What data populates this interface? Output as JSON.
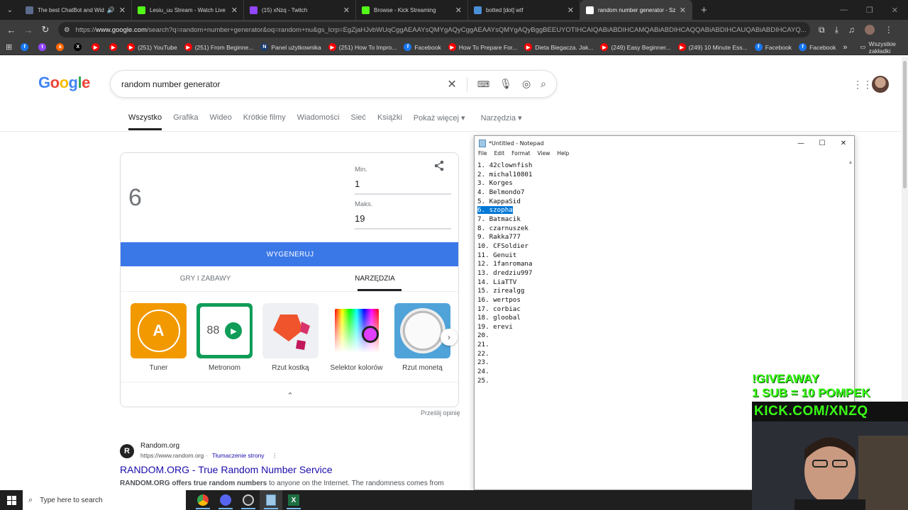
{
  "browser": {
    "tabs": [
      {
        "label": "The best ChatBot and Widg",
        "color": "#5a6b8c",
        "audio": true
      },
      {
        "label": "Lesiu_uu Stream - Watch Live o",
        "color": "#53fc18"
      },
      {
        "label": "(15) xNzq - Twitch",
        "color": "#9146ff"
      },
      {
        "label": "Browse - Kick Streaming",
        "color": "#53fc18"
      },
      {
        "label": "botted [dot] wtf",
        "color": "#4a90d9"
      },
      {
        "label": "random number generator - Sz",
        "color": "#ffffff",
        "active": true
      }
    ],
    "url_prefix": "https://",
    "url_host": "www.google.com",
    "url_rest": "/search?q=random+number+generator&oq=random+nu&gs_lcrp=EgZjaHJvbWUqCggAEAAYsQMYgAQyCggAEAAYsQMYgAQyBggBEEUYOTIHCAIQABiABDIHCAMQABiABDIHCAQQABiABDIHCAUQABiABDIHCAYQ...",
    "bookmarks": [
      {
        "label": "",
        "color": "#1877f2",
        "glyph": "f"
      },
      {
        "label": "",
        "color": "#9146ff",
        "glyph": "t"
      },
      {
        "label": "",
        "color": "#ff6600",
        "glyph": "a"
      },
      {
        "label": "",
        "color": "#000000",
        "glyph": "X"
      },
      {
        "label": "",
        "color": "#ff0000",
        "glyph": "▶"
      },
      {
        "label": "",
        "color": "#ff0000",
        "glyph": "▶"
      },
      {
        "label": "(251) YouTube",
        "color": "#ff0000",
        "glyph": "▶"
      },
      {
        "label": "(251) From Beginne...",
        "color": "#ff0000",
        "glyph": "▶"
      },
      {
        "label": "Panel użytkownika",
        "color": "#1a3c6e",
        "glyph": "N"
      },
      {
        "label": "(251) How To Impro...",
        "color": "#ff0000",
        "glyph": "▶"
      },
      {
        "label": "Facebook",
        "color": "#1877f2",
        "glyph": "f"
      },
      {
        "label": "How To Prepare For...",
        "color": "#ff0000",
        "glyph": "▶"
      },
      {
        "label": "Dieta Biegacza. Jak...",
        "color": "#ff0000",
        "glyph": "▶"
      },
      {
        "label": "(249) Easy Beginner...",
        "color": "#ff0000",
        "glyph": "▶"
      },
      {
        "label": "(249) 10 Minute Ess...",
        "color": "#ff0000",
        "glyph": "▶"
      },
      {
        "label": "Facebook",
        "color": "#1877f2",
        "glyph": "f"
      },
      {
        "label": "Facebook",
        "color": "#1877f2",
        "glyph": "f"
      }
    ],
    "bookmarks_more": "»",
    "all_bookmarks": "Wszystkie zakładki"
  },
  "google": {
    "logo": "Google",
    "query": "random number generator",
    "tabs": [
      "Wszystko",
      "Grafika",
      "Wideo",
      "Krótkie filmy",
      "Wiadomości",
      "Sieć",
      "Książki",
      "Pokaż więcej ▾",
      "Narzędzia ▾"
    ],
    "rng": {
      "result": "6",
      "min_label": "Min.",
      "min_value": "1",
      "max_label": "Maks.",
      "max_value": "19",
      "button": "WYGENERUJ",
      "subtabs": [
        "GRY I ZABAWY",
        "NARZĘDZIA"
      ],
      "tools": [
        "Tuner",
        "Metronom",
        "Rzut kostką",
        "Selektor kolorów",
        "Rzut monetą"
      ],
      "metronome_bpm": "88",
      "tuner_letter": "A"
    },
    "feedback": "Prześlij opinię",
    "result": {
      "site": "Random.org",
      "url": "https://www.random.org",
      "translate": "Tłumaczenie strony",
      "title": "RANDOM.ORG - True Random Number Service",
      "snippet_bold": "RANDOM.ORG offers true random numbers",
      "snippet_rest": " to anyone on the Internet. The randomness comes from"
    }
  },
  "notepad": {
    "title": "*Untitled - Notepad",
    "menu": [
      "File",
      "Edit",
      "Format",
      "View",
      "Help"
    ],
    "lines": [
      "1. 42clownfish",
      "2. michal10801",
      "3. Korges",
      "4. Belmondo7",
      "5. KappaSid",
      "6. szopha",
      "7. Batmacik",
      "8. czarnuszek",
      "9. Rakka777",
      "10. CFSoldier",
      "11. Genuit",
      "12. 1fanromana",
      "13. dredziu997",
      "14. LiaTTV",
      "15. zirealgg",
      "16. wertpos",
      "17. corbiac",
      "18. gloobal",
      "19. erevi",
      "20.",
      "21.",
      "22.",
      "23.",
      "24.",
      "25."
    ],
    "selected_index": 5
  },
  "overlay": {
    "line1": "!GIVEAWAY",
    "line2": "1 SUB = 10 POMPEK",
    "banner": "KICK.COM/XNZQ"
  },
  "taskbar": {
    "search_placeholder": "Type here to search"
  }
}
